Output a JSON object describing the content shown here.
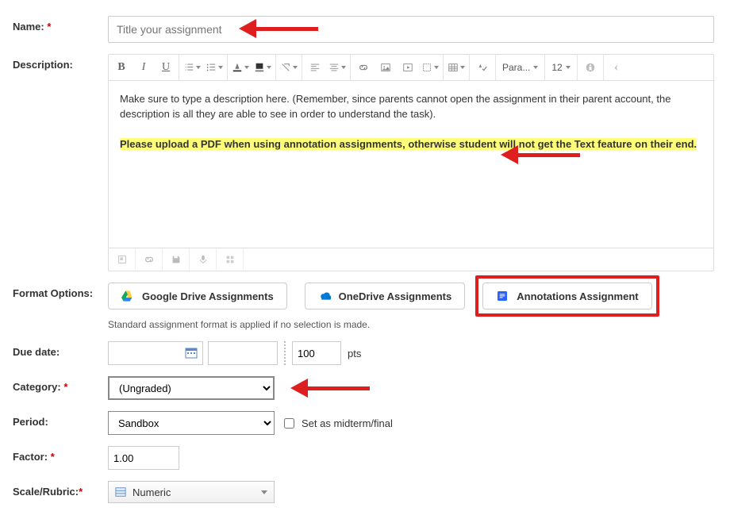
{
  "labels": {
    "name": "Name:",
    "description": "Description:",
    "format_options": "Format Options:",
    "due_date": "Due date:",
    "category": "Category:",
    "period": "Period:",
    "factor": "Factor:",
    "scale_rubric": "Scale/Rubric:"
  },
  "required_mark": "*",
  "name": {
    "placeholder": "Title your assignment",
    "value": ""
  },
  "editor": {
    "toolbar": {
      "bold": "B",
      "italic": "I",
      "underline": "U",
      "paragraph_label": "Para...",
      "fontsize_label": "12"
    },
    "text1": "Make sure to type a description here. (Remember, since parents cannot open the assignment in their parent account, the description is all they are able to see in order to understand the task).",
    "highlight": "Please upload a PDF when using annotation assignments, otherwise student will not get the Text feature on their end."
  },
  "format_options": {
    "google": "Google Drive Assignments",
    "onedrive": "OneDrive Assignments",
    "annotations": "Annotations Assignment",
    "hint": "Standard assignment format is applied if no selection is made."
  },
  "due_date": {
    "points_value": "100",
    "points_label": "pts"
  },
  "category": {
    "selected": "(Ungraded)"
  },
  "period": {
    "selected": "Sandbox",
    "midterm_label": "Set as midterm/final"
  },
  "factor": {
    "value": "1.00"
  },
  "scale_rubric": {
    "selected": "Numeric"
  }
}
